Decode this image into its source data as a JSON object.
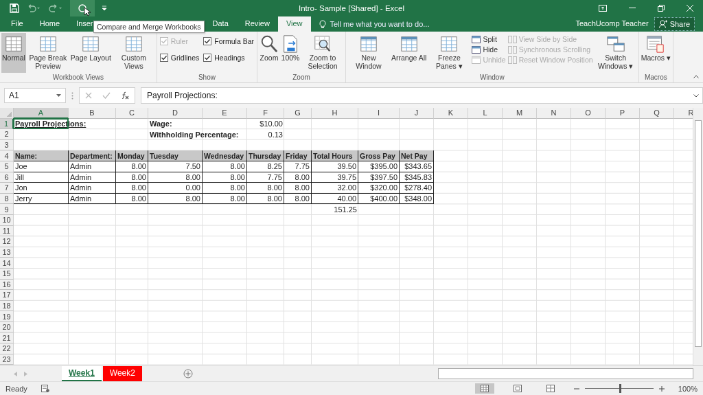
{
  "window": {
    "title": "Intro- Sample  [Shared] - Excel",
    "user": "TeachUcomp Teacher",
    "share": "Share"
  },
  "tooltip": "Compare and Merge Workbooks",
  "tabs": [
    {
      "label": "File",
      "selected": false
    },
    {
      "label": "Home",
      "selected": false
    },
    {
      "label": "Inser",
      "selected": false
    },
    {
      "label": "Data",
      "selected": false
    },
    {
      "label": "Review",
      "selected": false
    },
    {
      "label": "View",
      "selected": true
    }
  ],
  "tell_me": {
    "placeholder": "Tell me what you want to do..."
  },
  "ribbon": {
    "groups": [
      {
        "name": "Workbook Views",
        "kind": "big",
        "items": [
          {
            "label": "Normal",
            "kind": "sheet",
            "selected": true
          },
          {
            "label": "Page Break Preview",
            "kind": "sheet",
            "selected": false
          },
          {
            "label": "Page Layout",
            "kind": "sheet",
            "selected": false
          },
          {
            "label": "Custom Views",
            "kind": "sheet",
            "selected": false
          }
        ]
      },
      {
        "name": "Show",
        "kind": "checks",
        "items": [
          {
            "label": "Ruler",
            "checked": true,
            "disabled": true
          },
          {
            "label": "Formula Bar",
            "checked": true,
            "disabled": false
          },
          {
            "label": "Gridlines",
            "checked": true,
            "disabled": false
          },
          {
            "label": "Headings",
            "checked": true,
            "disabled": false
          }
        ]
      },
      {
        "name": "Zoom",
        "kind": "big",
        "items": [
          {
            "label": "Zoom",
            "kind": "magnifier",
            "selected": false
          },
          {
            "label": "100%",
            "kind": "document",
            "selected": false
          },
          {
            "label": "Zoom to Selection",
            "kind": "selection",
            "selected": false
          }
        ]
      },
      {
        "name": "Window",
        "kind": "window",
        "items": [
          {
            "label": "New Window",
            "kind": "window",
            "selected": false
          },
          {
            "label": "Arrange All",
            "kind": "window",
            "selected": false
          },
          {
            "label": "Freeze Panes ▾",
            "kind": "sheet",
            "selected": false
          }
        ],
        "small": [
          {
            "label": "Split",
            "disabled": false
          },
          {
            "label": "Hide",
            "disabled": false
          },
          {
            "label": "Unhide",
            "disabled": true
          }
        ],
        "small2": [
          {
            "label": "View Side by Side",
            "disabled": true
          },
          {
            "label": "Synchronous Scrolling",
            "disabled": true
          },
          {
            "label": "Reset Window Position",
            "disabled": true
          }
        ],
        "after": [
          {
            "label": "Switch Windows ▾",
            "kind": "windows",
            "selected": false
          }
        ]
      },
      {
        "name": "Macros",
        "kind": "big",
        "items": [
          {
            "label": "Macros ▾",
            "kind": "macro",
            "selected": false
          }
        ]
      }
    ]
  },
  "formula_bar": {
    "name_box": "A1",
    "value": "Payroll Projections:"
  },
  "grid": {
    "columns": [
      "A",
      "B",
      "C",
      "D",
      "E",
      "F",
      "G",
      "H",
      "I",
      "J",
      "K",
      "L",
      "M",
      "N",
      "O",
      "P",
      "Q",
      "R"
    ],
    "rows": [
      {
        "number": "1",
        "kind": "title",
        "cells": {
          "A": {
            "text": "Payroll Projections:",
            "selected": true
          },
          "D": {
            "text": "Wage:",
            "selected": false
          },
          "F": {
            "text": "$10.00",
            "selected": false
          }
        }
      },
      {
        "number": "2",
        "kind": "info",
        "cells": {
          "D": {
            "text": "Withholding Percentage:",
            "selected": false
          },
          "F": {
            "text": "0.13",
            "selected": false
          }
        }
      },
      {
        "number": "3"
      },
      {
        "number": "4",
        "kind": "header",
        "cells": {
          "A": {
            "text": "Name:",
            "selected": false
          },
          "B": {
            "text": "Department:",
            "selected": false
          },
          "C": {
            "text": "Monday",
            "selected": false
          },
          "D": {
            "text": "Tuesday",
            "selected": false
          },
          "E": {
            "text": "Wednesday",
            "selected": false
          },
          "F": {
            "text": "Thursday",
            "selected": false
          },
          "G": {
            "text": "Friday",
            "selected": false
          },
          "H": {
            "text": "Total Hours",
            "selected": false
          },
          "I": {
            "text": "Gross Pay",
            "selected": false
          },
          "J": {
            "text": "Net Pay",
            "selected": false
          }
        }
      },
      {
        "number": "5",
        "kind": "data",
        "cells": {
          "A": {
            "text": "Joe",
            "selected": false
          },
          "B": {
            "text": "Admin",
            "selected": false
          },
          "C": {
            "text": "8.00",
            "selected": false
          },
          "D": {
            "text": "7.50",
            "selected": false
          },
          "E": {
            "text": "8.00",
            "selected": false
          },
          "F": {
            "text": "8.25",
            "selected": false
          },
          "G": {
            "text": "7.75",
            "selected": false
          },
          "H": {
            "text": "39.50",
            "selected": false
          },
          "I": {
            "text": "$395.00",
            "selected": false
          },
          "J": {
            "text": "$343.65",
            "selected": false
          }
        }
      },
      {
        "number": "6",
        "kind": "data",
        "cells": {
          "A": {
            "text": "Jill",
            "selected": false
          },
          "B": {
            "text": "Admin",
            "selected": false
          },
          "C": {
            "text": "8.00",
            "selected": false
          },
          "D": {
            "text": "8.00",
            "selected": false
          },
          "E": {
            "text": "8.00",
            "selected": false
          },
          "F": {
            "text": "7.75",
            "selected": false
          },
          "G": {
            "text": "8.00",
            "selected": false
          },
          "H": {
            "text": "39.75",
            "selected": false
          },
          "I": {
            "text": "$397.50",
            "selected": false
          },
          "J": {
            "text": "$345.83",
            "selected": false
          }
        }
      },
      {
        "number": "7",
        "kind": "data",
        "cells": {
          "A": {
            "text": "Jon",
            "selected": false
          },
          "B": {
            "text": "Admin",
            "selected": false
          },
          "C": {
            "text": "8.00",
            "selected": false
          },
          "D": {
            "text": "0.00",
            "selected": false
          },
          "E": {
            "text": "8.00",
            "selected": false
          },
          "F": {
            "text": "8.00",
            "selected": false
          },
          "G": {
            "text": "8.00",
            "selected": false
          },
          "H": {
            "text": "32.00",
            "selected": false
          },
          "I": {
            "text": "$320.00",
            "selected": false
          },
          "J": {
            "text": "$278.40",
            "selected": false
          }
        }
      },
      {
        "number": "8",
        "kind": "data",
        "cells": {
          "A": {
            "text": "Jerry",
            "selected": false
          },
          "B": {
            "text": "Admin",
            "selected": false
          },
          "C": {
            "text": "8.00",
            "selected": false
          },
          "D": {
            "text": "8.00",
            "selected": false
          },
          "E": {
            "text": "8.00",
            "selected": false
          },
          "F": {
            "text": "8.00",
            "selected": false
          },
          "G": {
            "text": "8.00",
            "selected": false
          },
          "H": {
            "text": "40.00",
            "selected": false
          },
          "I": {
            "text": "$400.00",
            "selected": false
          },
          "J": {
            "text": "$348.00",
            "selected": false
          }
        }
      },
      {
        "number": "9",
        "kind": "total",
        "cells": {
          "H": {
            "text": "151.25",
            "selected": false
          }
        }
      },
      {
        "number": "10"
      },
      {
        "number": "11"
      },
      {
        "number": "12"
      },
      {
        "number": "13"
      },
      {
        "number": "14"
      },
      {
        "number": "15"
      },
      {
        "number": "16"
      },
      {
        "number": "17"
      },
      {
        "number": "18"
      },
      {
        "number": "19"
      },
      {
        "number": "20"
      },
      {
        "number": "21"
      },
      {
        "number": "22"
      },
      {
        "number": "23"
      }
    ]
  },
  "sheets": [
    {
      "label": "Week1",
      "selected": true,
      "color": "#217346"
    },
    {
      "label": "Week2",
      "selected": false,
      "color": "#ff0000"
    }
  ],
  "status_bar": {
    "text": "Ready",
    "views": [
      {
        "kind": "normal",
        "selected": true
      },
      {
        "kind": "layout",
        "selected": false
      },
      {
        "kind": "pagebreak",
        "selected": false
      }
    ],
    "zoom": {
      "level": 0.5,
      "reading": "100%"
    }
  }
}
